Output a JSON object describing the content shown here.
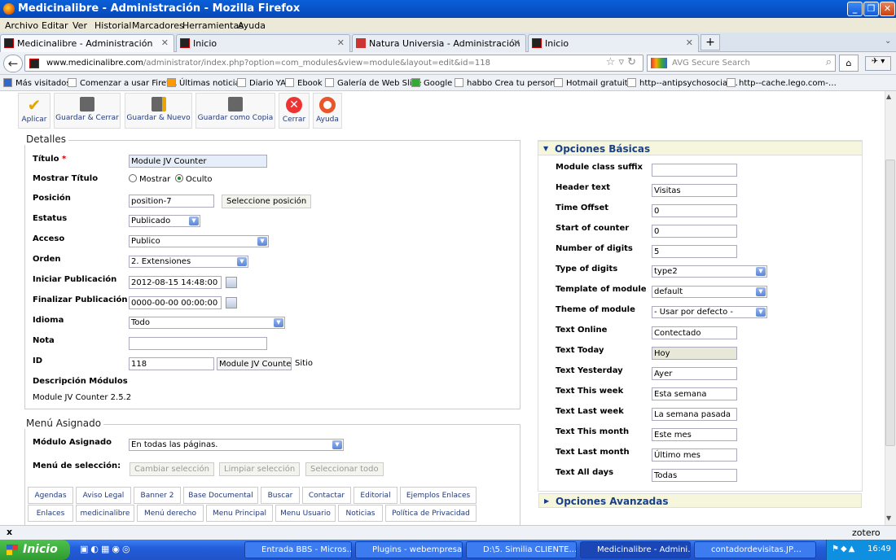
{
  "window": {
    "title": "Medicinalibre - Administración - Mozilla Firefox",
    "minimize": "_",
    "maximize": "❐",
    "close": "✕"
  },
  "menu": [
    "Archivo",
    "Editar",
    "Ver",
    "Historial",
    "Marcadores",
    "Herramientas",
    "Ayuda"
  ],
  "tabs": [
    {
      "label": "Medicinalibre - Administración",
      "close": "✕"
    },
    {
      "label": "Inicio",
      "close": "✕"
    },
    {
      "label": "Natura Universia - Administración",
      "close": "✕"
    },
    {
      "label": "Inicio",
      "close": "✕"
    }
  ],
  "new_tab": "+",
  "nav": {
    "url_domain": "www.medicinalibre.com",
    "url_path": "/administrator/index.php?option=com_modules&view=module&layout=edit&id=118",
    "search_placeholder": "AVG Secure Search",
    "back": "←",
    "home": "⌂"
  },
  "bookmarks": [
    "Más visitados",
    "Comenzar a usar Firef…",
    "Últimas noticias",
    "Diario YA",
    "Ebook",
    "Galería de Web Slice",
    "Google",
    "habbo Crea tu person…",
    "Hotmail gratuito",
    "http--antipsychosocial…",
    "http--cache.lego.com-…"
  ],
  "toolbar": [
    "Aplicar",
    "Guardar & Cerrar",
    "Guardar & Nuevo",
    "Guardar como Copia",
    "Cerrar",
    "Ayuda"
  ],
  "detalles": {
    "legend": "Detalles",
    "titulo_label": "Título",
    "required_mark": "*",
    "titulo_value": "Module JV Counter",
    "mostrar_titulo_label": "Mostrar Título",
    "mostrar_option": "Mostrar",
    "oculto_option": "Oculto",
    "posicion_label": "Posición",
    "posicion_value": "position-7",
    "seleccione_button": "Seleccione posición",
    "estatus_label": "Estatus",
    "estatus_value": "Publicado",
    "acceso_label": "Acceso",
    "acceso_value": "Publico",
    "orden_label": "Orden",
    "orden_value": "2. Extensiones",
    "iniciar_label": "Iniciar Publicación",
    "iniciar_value": "2012-08-15 14:48:00",
    "finalizar_label": "Finalizar Publicación",
    "finalizar_value": "0000-00-00 00:00:00",
    "idioma_label": "Idioma",
    "idioma_value": "Todo",
    "nota_label": "Nota",
    "nota_value": "",
    "id_label": "ID",
    "id_value": "118",
    "id_module": "Module JV Counter",
    "id_site": "Sitio",
    "desc_label": "Descripción Módulos",
    "desc_value": "Module JV Counter 2.5.2"
  },
  "menu_asignado": {
    "legend": "Menú Asignado",
    "modulo_label": "Módulo Asignado",
    "modulo_value": "En todas las páginas.",
    "seleccion_label": "Menú de selección:",
    "cambiar": "Cambiar selección",
    "limpiar": "Limpiar selección",
    "seleccionar": "Seleccionar todo",
    "tabs_row1": [
      "Agendas",
      "Aviso Legal",
      "Banner 2",
      "Base Documental",
      "Buscar",
      "Contactar",
      "Editorial",
      "Ejemplos Enlaces"
    ],
    "tabs_row2": [
      "Enlaces",
      "medicinalibre",
      "Menú derecho",
      "Menu Principal",
      "Menu Usuario",
      "Noticias",
      "Política de Privacidad"
    ]
  },
  "opciones_basicas": {
    "title": "Opciones Básicas",
    "fields": [
      {
        "label": "Module class suffix",
        "value": "",
        "type": "input"
      },
      {
        "label": "Header text",
        "value": "Visitas",
        "type": "input"
      },
      {
        "label": "Time Offset",
        "value": "0",
        "type": "input"
      },
      {
        "label": "Start of counter",
        "value": "0",
        "type": "input"
      },
      {
        "label": "Number of digits",
        "value": "5",
        "type": "input"
      },
      {
        "label": "Type of digits",
        "value": "type2",
        "type": "select"
      },
      {
        "label": "Template of module",
        "value": "default",
        "type": "select"
      },
      {
        "label": "Theme of module",
        "value": "- Usar por defecto -",
        "type": "select"
      },
      {
        "label": "Text Online",
        "value": "Contectado",
        "type": "input"
      },
      {
        "label": "Text Today",
        "value": "Hoy",
        "type": "input-focus"
      },
      {
        "label": "Text Yesterday",
        "value": "Ayer",
        "type": "input"
      },
      {
        "label": "Text This week",
        "value": "Esta semana",
        "type": "input"
      },
      {
        "label": "Text Last week",
        "value": "La semana pasada",
        "type": "input"
      },
      {
        "label": "Text This month",
        "value": "Este mes",
        "type": "input"
      },
      {
        "label": "Text Last month",
        "value": "Último mes",
        "type": "input"
      },
      {
        "label": "Text All days",
        "value": "Todas",
        "type": "input"
      }
    ]
  },
  "opciones_avanzadas": {
    "title": "Opciones Avanzadas"
  },
  "statusbar": {
    "close": "x",
    "right": "zotero"
  },
  "taskbar": {
    "start": "Inicio",
    "tasks": [
      "Entrada BBS - Micros…",
      "Plugins - webempresa…",
      "D:\\5. Similia CLIENTE…",
      "Medicinalibre - Admini…",
      "contadordevisitas.JP…"
    ],
    "clock": "16:49"
  },
  "colors": {
    "accent": "#1a3f8a",
    "titlebar": "#0a5fd8",
    "option_bar": "#f6f6dc"
  }
}
